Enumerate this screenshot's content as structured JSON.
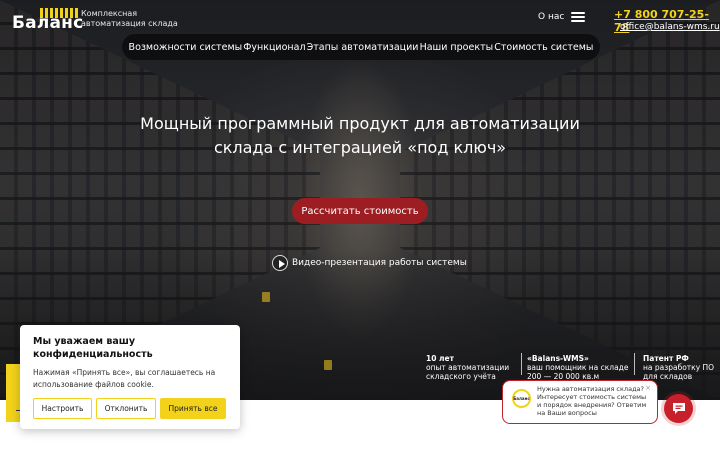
{
  "header": {
    "logo_text": "Баланс",
    "tagline": "Комплексная автоматизация склада",
    "about": "О нас",
    "phone": "+7 800 707-25-78",
    "email": "office@balans-wms.ru"
  },
  "nav": {
    "items": [
      {
        "label": "Возможности системы"
      },
      {
        "label": "Функционал"
      },
      {
        "label": "Этапы автоматизации"
      },
      {
        "label": "Наши проекты"
      },
      {
        "label": "Стоимость системы"
      }
    ]
  },
  "hero": {
    "headline_line1": "Мощный программный продукт для автоматизации",
    "headline_line2": "склада с интеграцией «под ключ»",
    "cta_label": "Рассчитать стоимость",
    "video_label": "Видео-презентация работы системы"
  },
  "stats": [
    {
      "title": "10 лет",
      "line1": "опыт автоматизации",
      "line2": "складского учёта"
    },
    {
      "title": "«Balans-WMS»",
      "line1": "ваш помощник на складе",
      "line2": "200 — 20 000 кв.м"
    },
    {
      "title": "Патент РФ",
      "line1": "на разработку ПО",
      "line2": "для складов"
    }
  ],
  "cookie": {
    "title": "Мы уважаем вашу конфиденциальность",
    "text": "Нажимая «Принять все», вы соглашаетесь на использование  файлов cookie.",
    "btn_settings": "Настроить",
    "btn_reject": "Отклонить",
    "btn_accept": "Принять все"
  },
  "chat": {
    "logo_text": "Баланс",
    "text": "Нужна автоматизация склада? Интересует стоимость системы и порядок внедрения? Ответим на Ваши вопросы",
    "close": "×"
  },
  "colors": {
    "accent_yellow": "#f2d21b",
    "cta_red": "#9c1e22",
    "chat_red": "#c8202a"
  },
  "icons": [
    "menu-icon",
    "play-icon",
    "chat-icon",
    "close-icon"
  ]
}
